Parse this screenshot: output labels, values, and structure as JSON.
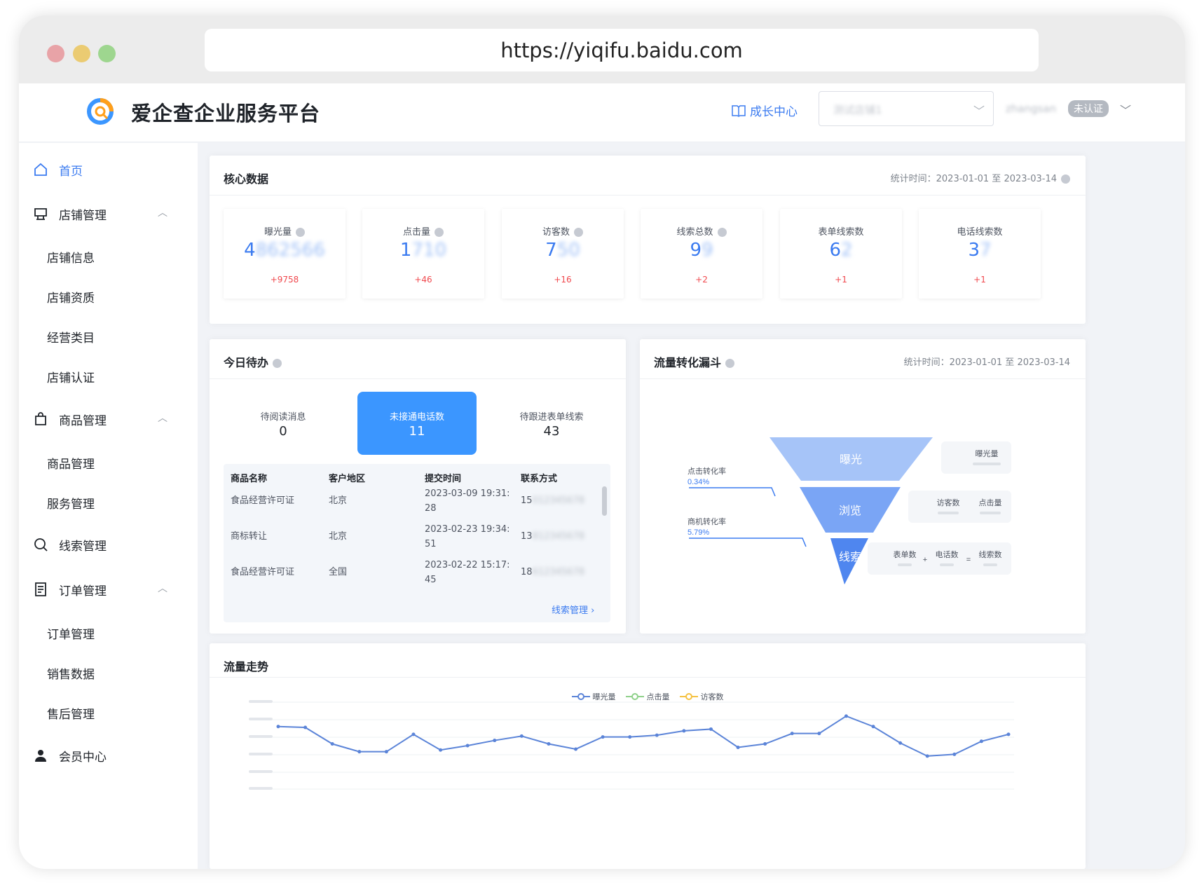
{
  "browser": {
    "url": "https://yiqifu.baidu.com"
  },
  "header": {
    "brand": "爱企查企业服务平台",
    "growth_center": "成长中心",
    "shop_select_value": "测试店铺1",
    "username": "zhangsan",
    "auth_badge": "未认证"
  },
  "sidebar": {
    "home": "首页",
    "shop_manage": "店铺管理",
    "shop_items": [
      "店铺信息",
      "店铺资质",
      "经营类目",
      "店铺认证"
    ],
    "goods_manage": "商品管理",
    "goods_items": [
      "商品管理",
      "服务管理"
    ],
    "leads_manage": "线索管理",
    "order_manage": "订单管理",
    "order_items": [
      "订单管理",
      "销售数据",
      "售后管理"
    ],
    "member_center": "会员中心"
  },
  "core": {
    "title": "核心数据",
    "stat_time": "统计时间：2023-01-01 至 2023-03-14",
    "metrics": [
      {
        "label": "曝光量",
        "value_first": "4",
        "value_rest": "862566",
        "delta": "+9758",
        "info": true
      },
      {
        "label": "点击量",
        "value_first": "1",
        "value_rest": "710",
        "delta": "+46",
        "info": true
      },
      {
        "label": "访客数",
        "value_first": "7",
        "value_rest": "50",
        "delta": "+16",
        "info": true
      },
      {
        "label": "线索总数",
        "value_first": "9",
        "value_rest": "9",
        "delta": "+2",
        "info": true
      },
      {
        "label": "表单线索数",
        "value_first": "6",
        "value_rest": "2",
        "delta": "+1",
        "info": false
      },
      {
        "label": "电话线索数",
        "value_first": "3",
        "value_rest": "7",
        "delta": "+1",
        "info": false
      }
    ]
  },
  "todo": {
    "title": "今日待办",
    "items": [
      {
        "label": "待阅读消息",
        "value": "0"
      },
      {
        "label": "未接通电话数",
        "value": "11"
      },
      {
        "label": "待跟进表单线索",
        "value": "43"
      }
    ],
    "columns": [
      "商品名称",
      "客户地区",
      "提交时间",
      "联系方式"
    ],
    "rows": [
      {
        "name": "食品经营许可证",
        "region": "北京",
        "time1": "2023-03-09 19:31:",
        "time2": "28",
        "phone": "15",
        "phone_rest": "012345678"
      },
      {
        "name": "商标转让",
        "region": "北京",
        "time1": "2023-02-23 19:34:",
        "time2": "51",
        "phone": "13",
        "phone_rest": "812345678"
      },
      {
        "name": "食品经营许可证",
        "region": "全国",
        "time1": "2023-02-22 15:17:",
        "time2": "45",
        "phone": "18",
        "phone_rest": "612345678"
      }
    ],
    "more": "线索管理 ›"
  },
  "funnel": {
    "title": "流量转化漏斗",
    "stat_time": "统计时间：2023-01-01 至 2023-03-14",
    "stages": [
      "曝光",
      "浏览",
      "线索"
    ],
    "click_rate_label": "点击转化率",
    "click_rate": "0.34%",
    "lead_rate_label": "商机转化率",
    "lead_rate": "5.79%",
    "side1": [
      "曝光量"
    ],
    "side2": [
      "访客数",
      "点击量"
    ],
    "side3": [
      "表单数",
      "电话数",
      "线索数"
    ],
    "op_plus": "+",
    "op_eq": "="
  },
  "trend": {
    "title": "流量走势",
    "chart_data": {
      "type": "line",
      "series": [
        {
          "name": "曝光量",
          "values": [
            72,
            71,
            52,
            43,
            43,
            63,
            45,
            50,
            56,
            61,
            52,
            46,
            60,
            60,
            62,
            67,
            69,
            48,
            52,
            64,
            64,
            84,
            72,
            53,
            38,
            40,
            55,
            63
          ]
        },
        {
          "name": "点击量",
          "values": []
        },
        {
          "name": "访客数",
          "values": []
        }
      ],
      "colors": [
        "#5b84d8",
        "#8fd18a",
        "#f5c242"
      ],
      "legend": "top-center",
      "grid": true
    }
  }
}
